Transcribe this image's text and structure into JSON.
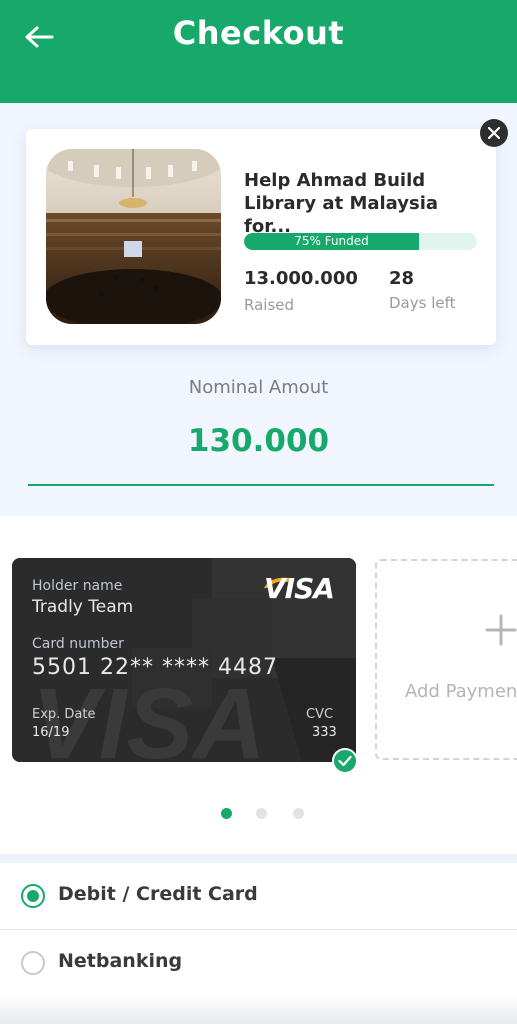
{
  "header": {
    "title": "Checkout",
    "back_icon": "arrow-left-icon"
  },
  "campaign": {
    "title": "Help Ahmad Build Library at Malaysia for...",
    "progress_percent": 75,
    "progress_label": "75% Funded",
    "raised_value": "13.000.000",
    "raised_label": "Raised",
    "days_value": "28",
    "days_label": "Days left",
    "close_icon": "close-icon"
  },
  "nominal": {
    "label": "Nominal Amout",
    "value": "130.000"
  },
  "card": {
    "brand": "VISA",
    "holder_label": "Holder name",
    "holder_name": "Tradly Team",
    "number_label": "Card number",
    "number": "5501 22** **** 4487",
    "exp_label": "Exp. Date",
    "exp_value": "16/19",
    "cvc_label": "CVC",
    "cvc_value": "333",
    "selected": true
  },
  "add_payment": {
    "label": "Add Payment",
    "icon": "plus-icon"
  },
  "pager": {
    "count": 3,
    "active": 0
  },
  "payment_options": [
    {
      "label": "Debit / Credit Card",
      "selected": true
    },
    {
      "label": "Netbanking",
      "selected": false
    }
  ],
  "colors": {
    "accent": "#17a86b",
    "background": "#eef2f9"
  }
}
